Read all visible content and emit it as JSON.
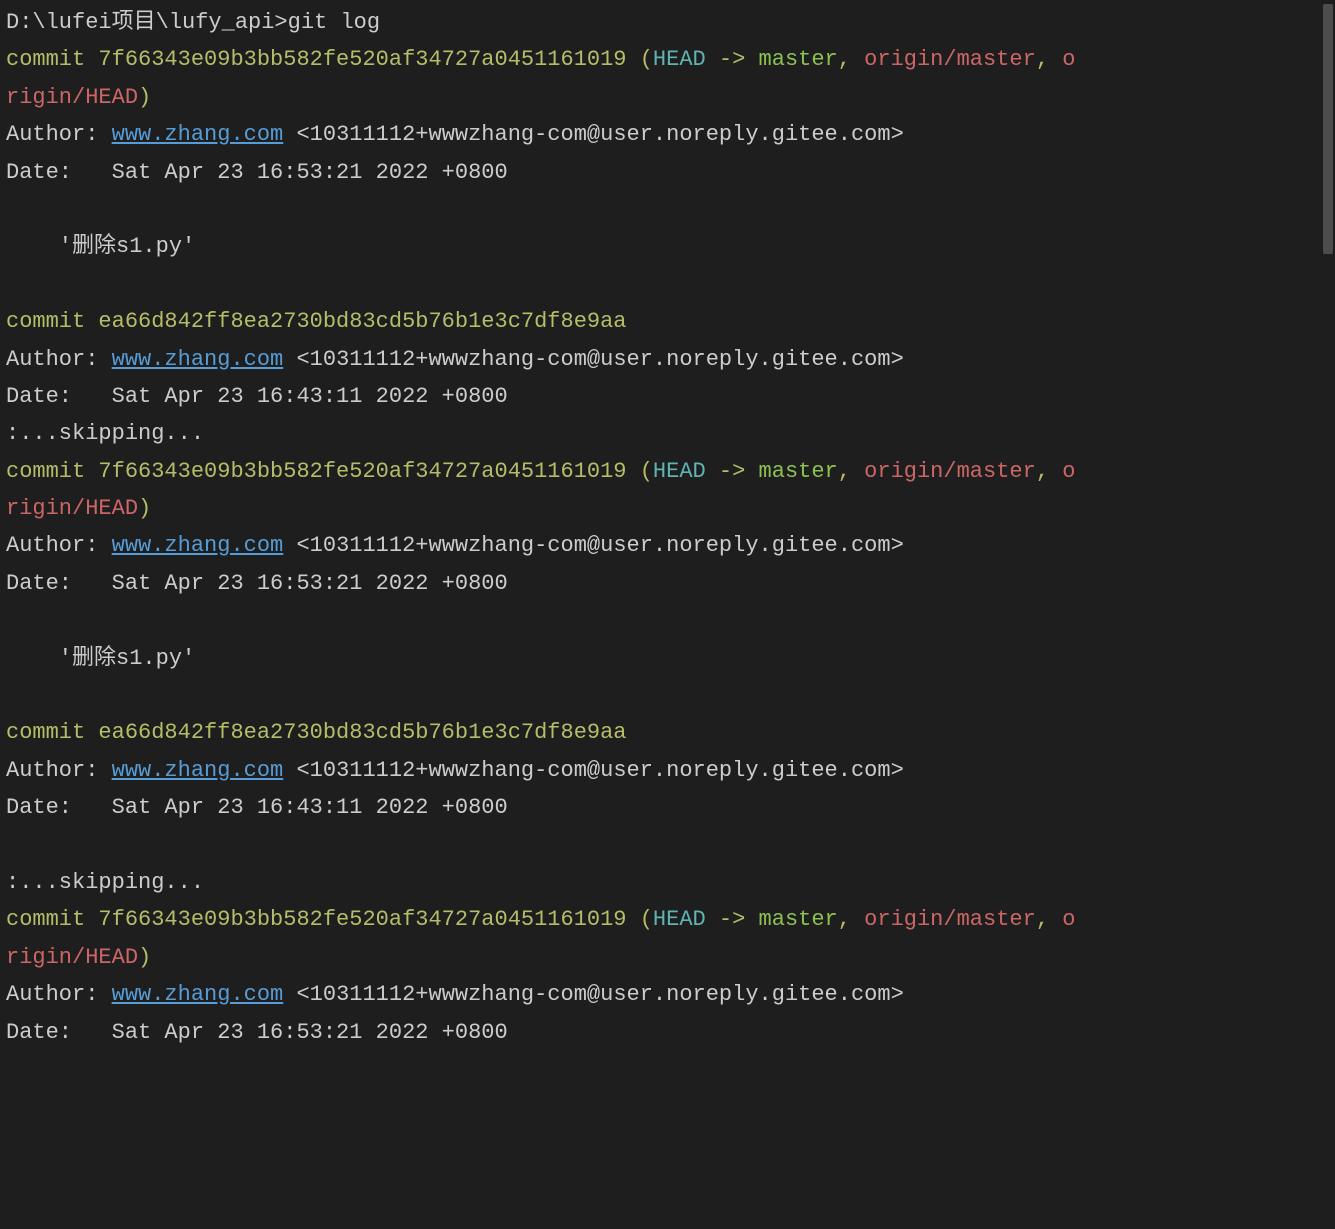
{
  "prompt": "D:\\lufei项目\\lufy_api>git log",
  "link_url": "www.zhang.com",
  "author_label": "Author: ",
  "author_email": " <10311112+wwwzhang-com@user.noreply.gitee.com>",
  "date_label": "Date:   ",
  "skipping": ":...skipping...",
  "commits": [
    {
      "commit_word": "commit ",
      "hash": "7f66343e09b3bb582fe520af34727a0451161019",
      "refs_open": " (",
      "head": "HEAD",
      "arrow": " -> ",
      "master": "master",
      "comma1": ", ",
      "origin_master": "origin/master",
      "comma2": ", ",
      "origin_head_line1": "o",
      "origin_head_line2": "rigin/HEAD",
      "refs_close": ")",
      "date": "Sat Apr 23 16:53:21 2022 +0800",
      "message": "    '删除s1.py'"
    },
    {
      "commit_word": "commit ",
      "hash": "ea66d842ff8ea2730bd83cd5b76b1e3c7df8e9aa",
      "date": "Sat Apr 23 16:43:11 2022 +0800"
    }
  ]
}
